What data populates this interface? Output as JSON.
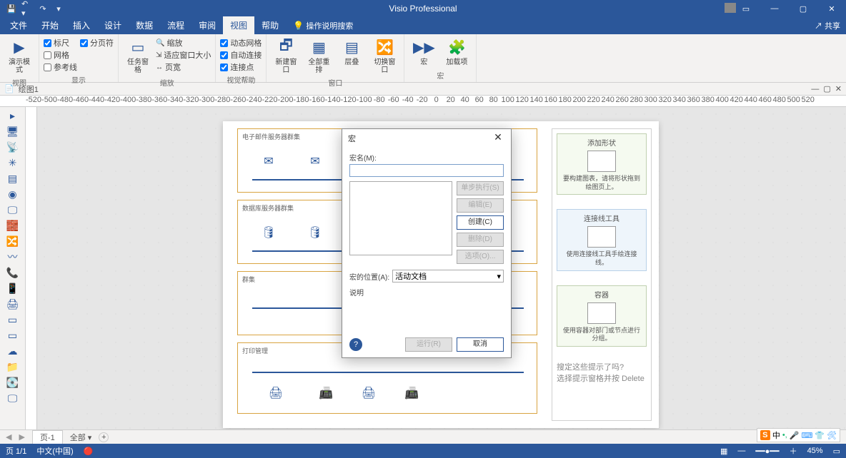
{
  "app": {
    "title": "Visio Professional"
  },
  "qat": [
    "save",
    "undo",
    "redo"
  ],
  "tabs": [
    "文件",
    "开始",
    "插入",
    "设计",
    "数据",
    "流程",
    "审阅",
    "视图",
    "帮助"
  ],
  "activeTab": "视图",
  "searchPlaceholder": "操作说明搜索",
  "share": "共享",
  "ribbon": {
    "g1": {
      "label": "视图",
      "btn": "演示模式"
    },
    "g2": {
      "label": "显示",
      "checks": [
        "标尺",
        "网格",
        "参考线",
        "分页符"
      ]
    },
    "g3": {
      "label": "缩放",
      "btn": "任务窗格",
      "zoom": "缩放",
      "fit": "适应窗口大小",
      "pw": "页宽"
    },
    "g4": {
      "label": "视觉帮助",
      "checks": [
        "动态网格",
        "自动连接",
        "连接点"
      ]
    },
    "g5": {
      "label": "窗口",
      "btns": [
        "新建窗口",
        "全部重排",
        "层叠",
        "切换窗口"
      ]
    },
    "g6": {
      "label": "宏",
      "btn": "宏",
      "addon": "加载项"
    }
  },
  "doc": {
    "name": "绘图1"
  },
  "ruler": [
    "-520",
    "-500",
    "-480",
    "-460",
    "-440",
    "-420",
    "-400",
    "-380",
    "-360",
    "-340",
    "-320",
    "-300",
    "-280",
    "-260",
    "-240",
    "-220",
    "-200",
    "-180",
    "-160",
    "-140",
    "-120",
    "-100",
    "-80",
    "-60",
    "-40",
    "-20",
    "0",
    "20",
    "40",
    "60",
    "80",
    "100",
    "120",
    "140",
    "160",
    "180",
    "200",
    "220",
    "240",
    "260",
    "280",
    "300",
    "320",
    "340",
    "360",
    "380",
    "400",
    "420",
    "440",
    "460",
    "480",
    "500",
    "520"
  ],
  "diagrams": [
    {
      "title": "电子邮件服务器群集"
    },
    {
      "title": "数据库服务器群集"
    },
    {
      "title": "群集"
    },
    {
      "title": "打印管理"
    }
  ],
  "panel": {
    "c1": {
      "title": "添加形状",
      "desc": "要构建图表，请将形状拖到绘图页上。"
    },
    "c2": {
      "title": "连接线工具",
      "desc": "使用连接线工具手绘连接线。"
    },
    "c3": {
      "title": "容器",
      "desc": "使用容器对部门或节点进行分组。"
    },
    "hint1": "搜定这些提示了吗?",
    "hint2": "选择提示窗格并按 Delete"
  },
  "dialog": {
    "title": "宏",
    "nameLabel": "宏名(M):",
    "btns": {
      "step": "单步执行(S)",
      "edit": "编辑(E)",
      "create": "创建(C)",
      "delete": "删除(D)",
      "options": "选项(O)..."
    },
    "locLabel": "宏的位置(A):",
    "locValue": "活动文档",
    "descLabel": "说明",
    "run": "运行(R)",
    "cancel": "取消"
  },
  "pagebar": {
    "page": "页-1",
    "all": "全部",
    "add": "+"
  },
  "status": {
    "pages": "页 1/1",
    "lang": "中文(中国)",
    "zoom": "45%"
  },
  "ime": {
    "mode": "中"
  }
}
